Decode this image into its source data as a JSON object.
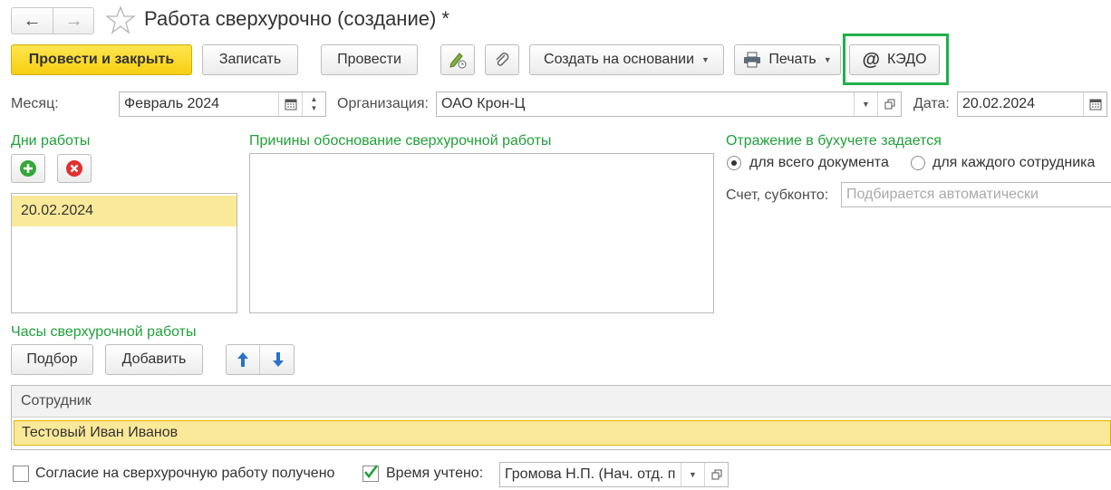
{
  "window": {
    "title": "Работа сверхурочно (создание) *"
  },
  "toolbar": {
    "post_close": "Провести и закрыть",
    "save": "Записать",
    "post": "Провести",
    "create_based": "Создать на основании",
    "print": "Печать",
    "kedo": "КЭДО"
  },
  "header": {
    "month_label": "Месяц:",
    "month_value": "Февраль 2024",
    "org_label": "Организация:",
    "org_value": "ОАО Крон-Ц",
    "date_label": "Дата:",
    "date_value": "20.02.2024"
  },
  "work_days": {
    "title": "Дни работы",
    "items": [
      "20.02.2024"
    ]
  },
  "reasons": {
    "title": "Причины обоснование сверхурочной работы",
    "value": ""
  },
  "accounting": {
    "title": "Отражение в бухучете задается",
    "option_document": "для всего документа",
    "option_employee": "для каждого сотрудника",
    "selected": "option_document",
    "account_label": "Счет, субконто:",
    "account_placeholder": "Подбирается автоматически"
  },
  "hours": {
    "title": "Часы сверхурочной работы",
    "pick_button": "Подбор",
    "add_button": "Добавить",
    "column_employee": "Сотрудник",
    "rows": [
      "Тестовый Иван Иванов"
    ]
  },
  "footer": {
    "consent_label": "Согласие на сверхурочную работу получено",
    "consent_checked": false,
    "time_counted_label": "Время учтено:",
    "time_counted_checked": true,
    "responsible_value": "Громова Н.П. (Нач. отд. п"
  },
  "colors": {
    "section_green": "#21a13a",
    "primary_yellow": "#f7cf12",
    "selected_row": "#fbe99a",
    "highlight_frame": "#21b04b"
  }
}
